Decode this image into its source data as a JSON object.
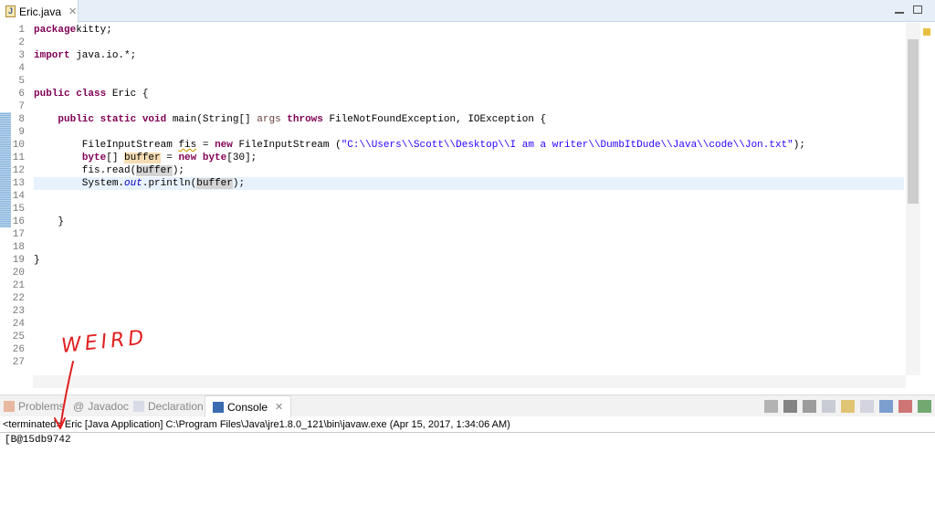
{
  "editor_tab": {
    "title": "Eric.java",
    "icon": "java-file-icon"
  },
  "code": [
    {
      "n": "1",
      "t": [
        [
          "kw",
          "package"
        ],
        [
          "",
          "kitty;"
        ]
      ]
    },
    {
      "n": "2",
      "t": []
    },
    {
      "n": "3",
      "t": [
        [
          "kw",
          "import"
        ],
        [
          "",
          " java.io.*;"
        ]
      ]
    },
    {
      "n": "4",
      "t": []
    },
    {
      "n": "5",
      "t": []
    },
    {
      "n": "6",
      "t": [
        [
          "kw",
          "public class"
        ],
        [
          "",
          " Eric {"
        ]
      ]
    },
    {
      "n": "7",
      "t": []
    },
    {
      "n": "8",
      "t": [
        [
          "",
          "    "
        ],
        [
          "kw",
          "public static void"
        ],
        [
          "",
          " main(String[] "
        ],
        [
          "arg",
          "args"
        ],
        [
          "",
          " "
        ],
        [
          "kw",
          "throws"
        ],
        [
          "",
          " FileNotFoundException, IOException {"
        ]
      ]
    },
    {
      "n": "9",
      "t": []
    },
    {
      "n": "10",
      "t": [
        [
          "",
          "        FileInputStream "
        ],
        [
          "warn",
          "fis"
        ],
        [
          "",
          " = "
        ],
        [
          "kw",
          "new"
        ],
        [
          "",
          " FileInputStream ("
        ],
        [
          "str",
          "\"C:\\\\Users\\\\Scott\\\\Desktop\\\\I am a writer\\\\DumbItDude\\\\Java\\\\code\\\\Jon.txt\""
        ],
        [
          "",
          ");"
        ]
      ]
    },
    {
      "n": "11",
      "t": [
        [
          "",
          "        "
        ],
        [
          "kw",
          "byte"
        ],
        [
          "",
          "[] "
        ],
        [
          "occw",
          "buffer"
        ],
        [
          "",
          " = "
        ],
        [
          "kw",
          "new byte"
        ],
        [
          "",
          "[30];"
        ]
      ]
    },
    {
      "n": "12",
      "t": [
        [
          "",
          "        fis.read("
        ],
        [
          "occ",
          "buffer"
        ],
        [
          "",
          ");"
        ]
      ]
    },
    {
      "n": "13",
      "t": [
        [
          "",
          "        System."
        ],
        [
          "it",
          "out"
        ],
        [
          "",
          ".println("
        ],
        [
          "occ",
          "buffer"
        ],
        [
          "",
          ");"
        ]
      ]
    },
    {
      "n": "14",
      "t": []
    },
    {
      "n": "15",
      "t": []
    },
    {
      "n": "16",
      "t": [
        [
          "",
          "    }"
        ]
      ]
    },
    {
      "n": "17",
      "t": []
    },
    {
      "n": "18",
      "t": []
    },
    {
      "n": "19",
      "t": [
        [
          "",
          "}"
        ]
      ]
    },
    {
      "n": "20",
      "t": []
    },
    {
      "n": "21",
      "t": []
    },
    {
      "n": "22",
      "t": []
    },
    {
      "n": "23",
      "t": []
    },
    {
      "n": "24",
      "t": []
    },
    {
      "n": "25",
      "t": []
    },
    {
      "n": "26",
      "t": []
    },
    {
      "n": "27",
      "t": []
    }
  ],
  "current_line": "13",
  "panel": {
    "tabs": [
      {
        "label": "Problems",
        "icon": "problems-icon"
      },
      {
        "label": "Javadoc",
        "icon": "at-icon"
      },
      {
        "label": "Declaration",
        "icon": "declaration-icon"
      },
      {
        "label": "Console",
        "icon": "console-icon"
      }
    ],
    "active_tab": "Console",
    "status": "<terminated> Eric [Java Application] C:\\Program Files\\Java\\jre1.8.0_121\\bin\\javaw.exe (Apr 15, 2017, 1:34:06 AM)",
    "output": "[B@15db9742",
    "tools": [
      "terminate-icon",
      "remove-launch-icon",
      "remove-all-icon",
      "clear-console-icon",
      "scroll-lock-icon",
      "word-wrap-icon",
      "show-on-stdout-icon",
      "show-on-stderr-icon",
      "open-console-icon"
    ]
  },
  "annotation": {
    "text": "WEIRD",
    "color": "#e02020"
  }
}
